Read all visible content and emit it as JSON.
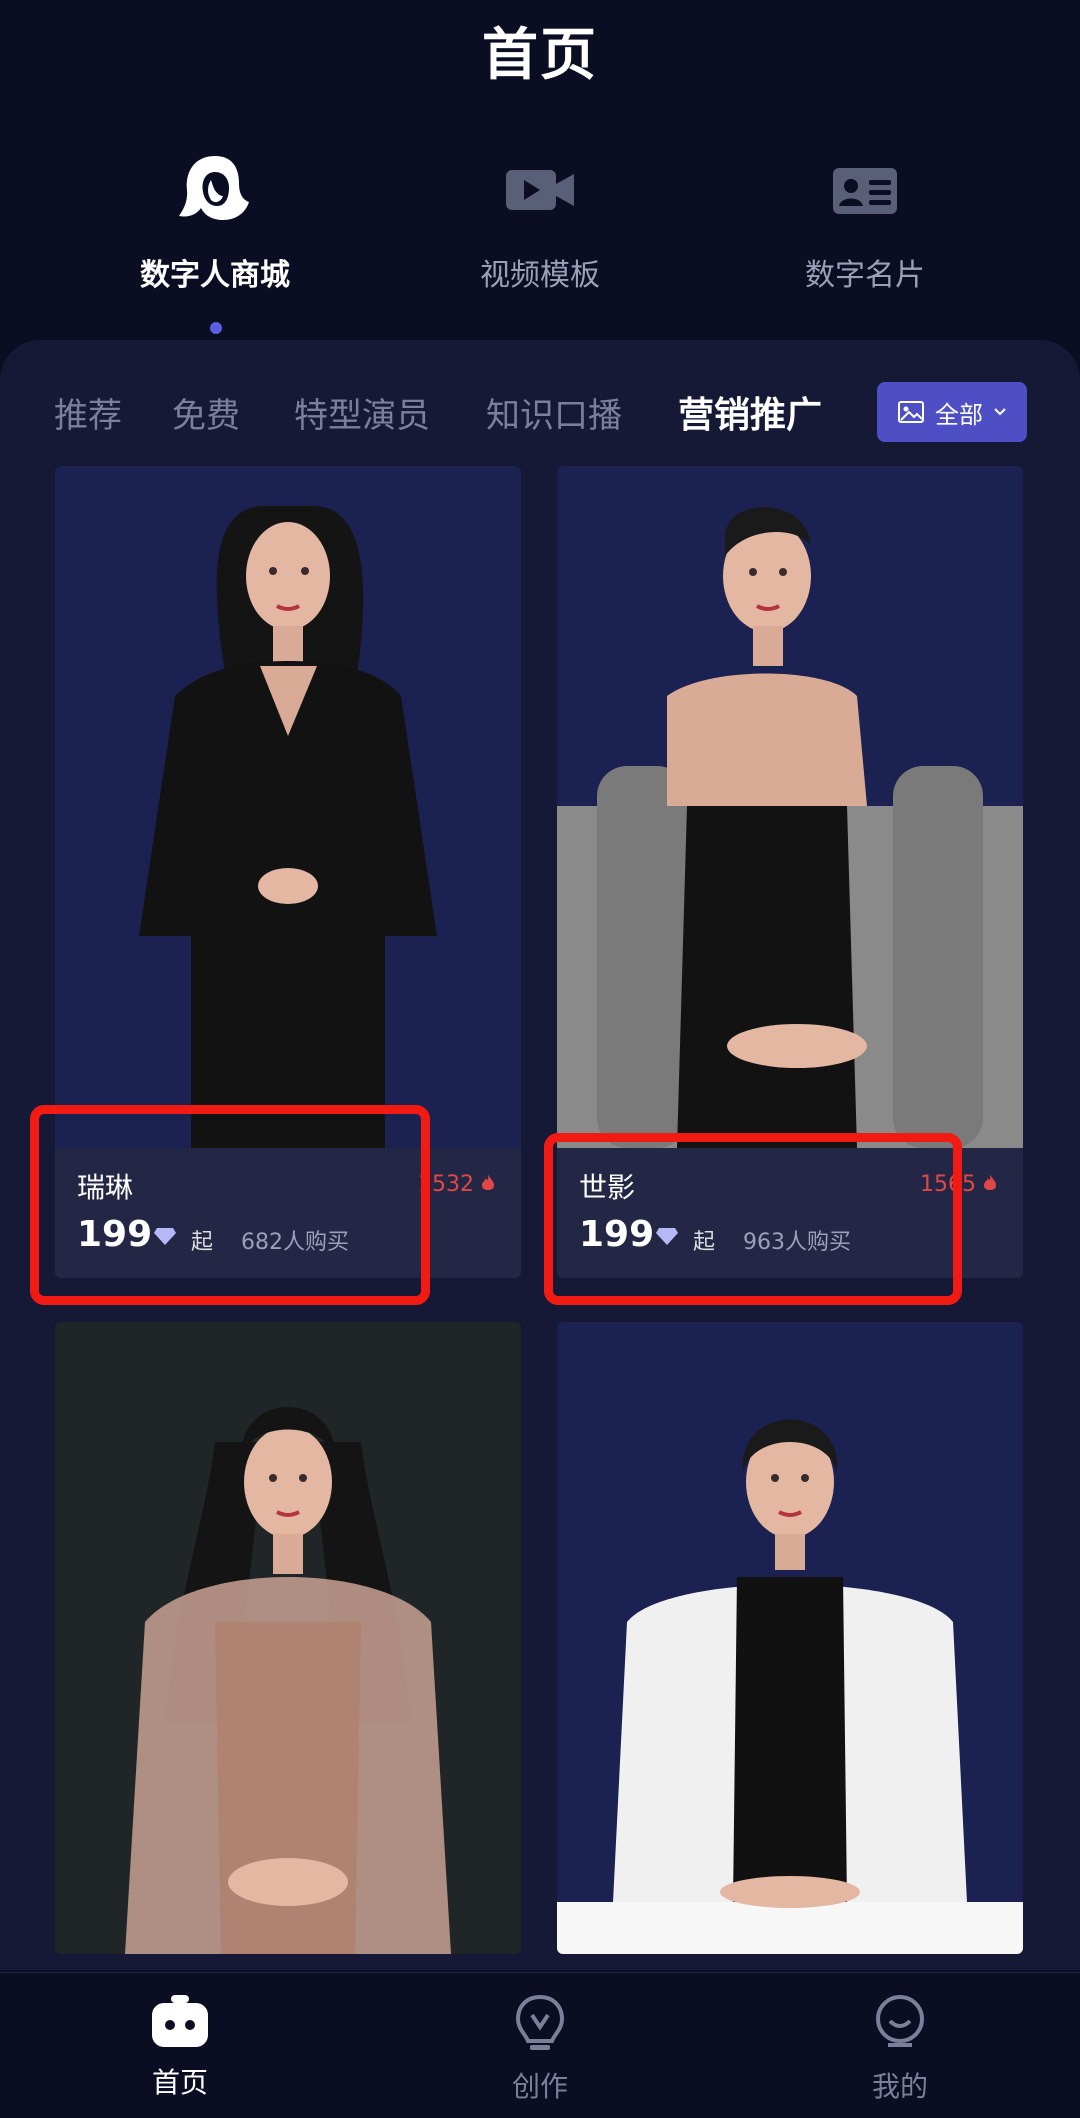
{
  "header": {
    "title": "首页"
  },
  "categories": [
    {
      "label": "数字人商城",
      "icon": "woman-head-icon",
      "active": true
    },
    {
      "label": "视频模板",
      "icon": "video-camera-icon",
      "active": false
    },
    {
      "label": "数字名片",
      "icon": "id-card-icon",
      "active": false
    }
  ],
  "tabs": [
    "推荐",
    "免费",
    "特型演员",
    "知识口播",
    "营销推广"
  ],
  "active_tab": "营销推广",
  "filter": {
    "label": "全部",
    "icon": "image-icon"
  },
  "products": [
    {
      "name": "瑞琳",
      "hot": "1532",
      "price": "199",
      "price_suffix": "起",
      "buyers": "682人购买"
    },
    {
      "name": "世影",
      "hot": "1565",
      "price": "199",
      "price_suffix": "起",
      "buyers": "963人购买"
    }
  ],
  "bottom_nav": [
    {
      "label": "首页",
      "icon": "home-robot-icon",
      "active": true
    },
    {
      "label": "创作",
      "icon": "lightbulb-icon",
      "active": false
    },
    {
      "label": "我的",
      "icon": "profile-icon",
      "active": false
    }
  ],
  "colors": {
    "background": "#0b0d22",
    "panel": "#151936",
    "card": "#232645",
    "accent": "#4e4fc4",
    "highlight": "#f21b14",
    "hot": "#e04848"
  }
}
